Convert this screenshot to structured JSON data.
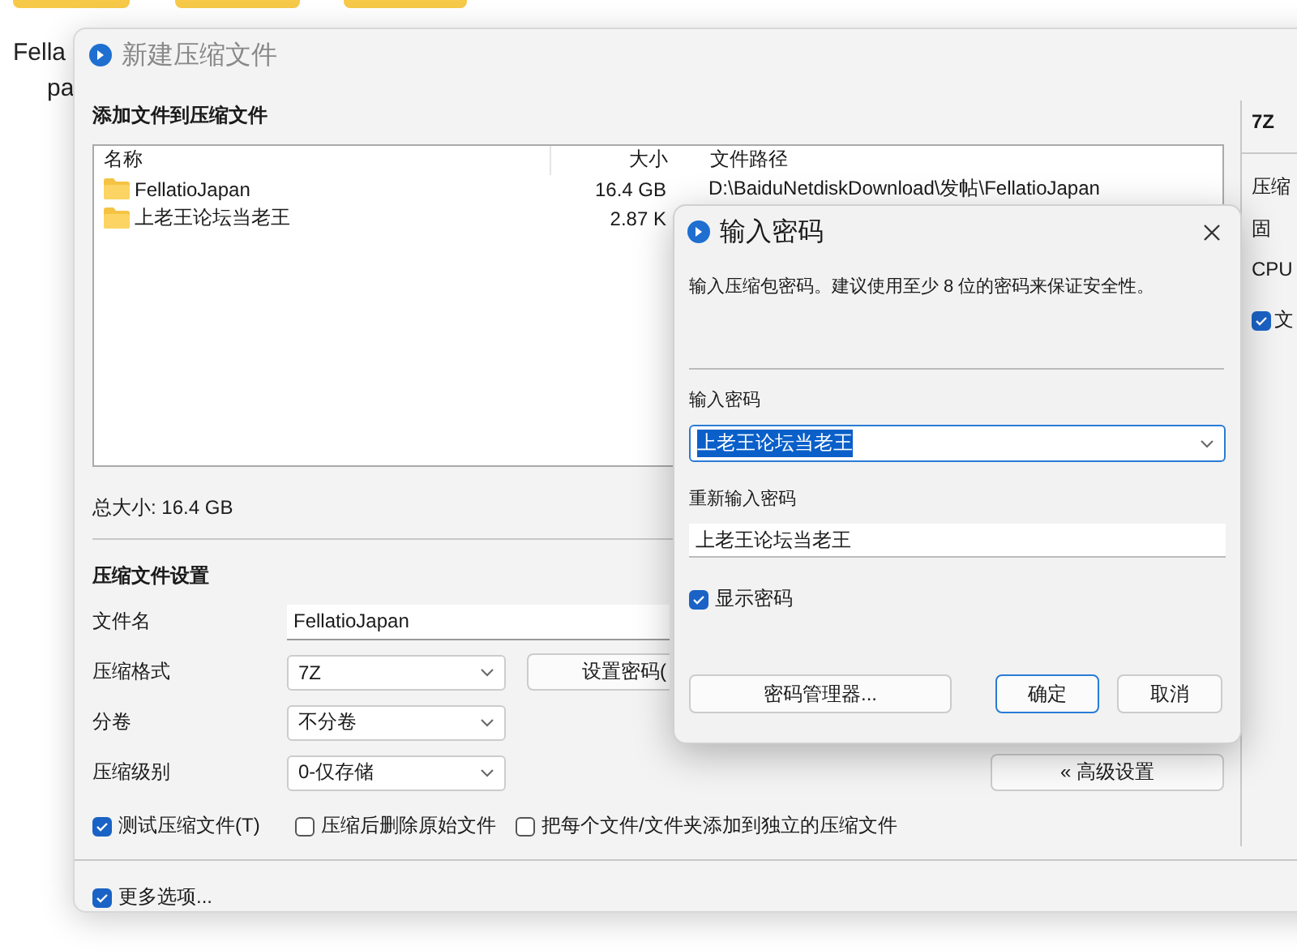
{
  "background": {
    "texts": [
      "Fella",
      "pa"
    ]
  },
  "main_window": {
    "title": "新建压缩文件",
    "section_title": "添加文件到压缩文件",
    "file_list": {
      "columns": [
        "名称",
        "大小",
        "文件路径"
      ],
      "rows": [
        {
          "name": "FellatioJapan",
          "size": "16.4 GB",
          "path": "D:\\BaiduNetdiskDownload\\发帖\\FellatioJapan"
        },
        {
          "name": "上老王论坛当老王",
          "size": "2.87 K"
        }
      ]
    },
    "total_size": "总大小: 16.4 GB",
    "settings": {
      "title": "压缩文件设置",
      "fields": [
        {
          "kind": "text",
          "label": "文件名",
          "value": "FellatioJapan"
        },
        {
          "kind": "select",
          "label": "压缩格式",
          "value": "7Z",
          "button": "设置密码("
        },
        {
          "kind": "select",
          "label": "分卷",
          "value": "不分卷"
        },
        {
          "kind": "select",
          "label": "压缩级别",
          "value": "0-仅存储",
          "button": "« 高级设置"
        }
      ],
      "checkboxes": [
        {
          "label": "测试压缩文件(T)",
          "checked": true
        },
        {
          "label": "压缩后删除原始文件",
          "checked": false
        },
        {
          "label": "把每个文件/文件夹添加到独立的压缩文件",
          "checked": false
        }
      ]
    },
    "more_options": {
      "label": "更多选项...",
      "checked": true
    },
    "side_panel": {
      "title": "7Z",
      "items": [
        {
          "kind": "text",
          "label": "压缩"
        },
        {
          "kind": "text",
          "label": "固"
        },
        {
          "kind": "text",
          "label": "CPU"
        },
        {
          "kind": "checkbox",
          "label": "文",
          "checked": true
        }
      ]
    }
  },
  "password_dialog": {
    "title": "输入密码",
    "description": "输入压缩包密码。建议使用至少 8 位的密码来保证安全性。",
    "password": {
      "label": "输入密码",
      "value": "上老王论坛当老王",
      "text_selected": true
    },
    "confirm": {
      "label": "重新输入密码",
      "value": "上老王论坛当老王"
    },
    "show_password": {
      "label": "显示密码",
      "checked": true
    },
    "buttons": [
      {
        "label": "密码管理器...",
        "focused": false
      },
      {
        "label": "确定",
        "focused": true
      },
      {
        "label": "取消",
        "focused": false
      }
    ]
  }
}
